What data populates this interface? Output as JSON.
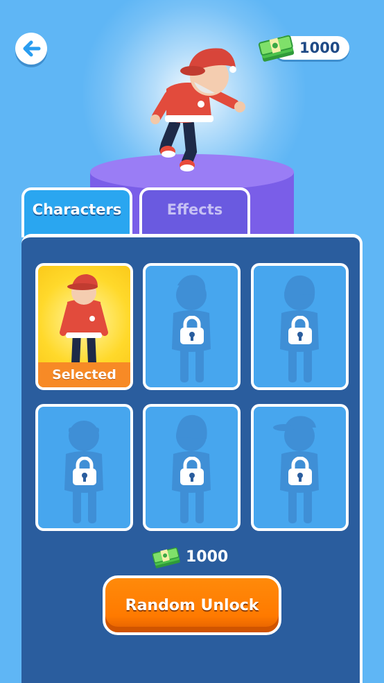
{
  "header": {
    "back_icon": "arrow-left-icon",
    "currency_amount": "1000",
    "currency_icon": "cash-stack-icon"
  },
  "tabs": [
    {
      "label": "Characters",
      "active": true
    },
    {
      "label": "Effects",
      "active": false
    }
  ],
  "characters": [
    {
      "state": "selected",
      "label": "Selected"
    },
    {
      "state": "locked"
    },
    {
      "state": "locked"
    },
    {
      "state": "locked"
    },
    {
      "state": "locked"
    },
    {
      "state": "locked"
    }
  ],
  "unlock": {
    "cost": "1000",
    "button_label": "Random Unlock"
  },
  "colors": {
    "background": "#5fb6f5",
    "panel": "#2a5d9e",
    "tab_active": "#2aa6f0",
    "tab_inactive": "#6a5ae0",
    "selected_card": "#ffd92b",
    "selected_label": "#f78a26",
    "locked_card": "#47a6ee",
    "button": "#ff7a00"
  }
}
